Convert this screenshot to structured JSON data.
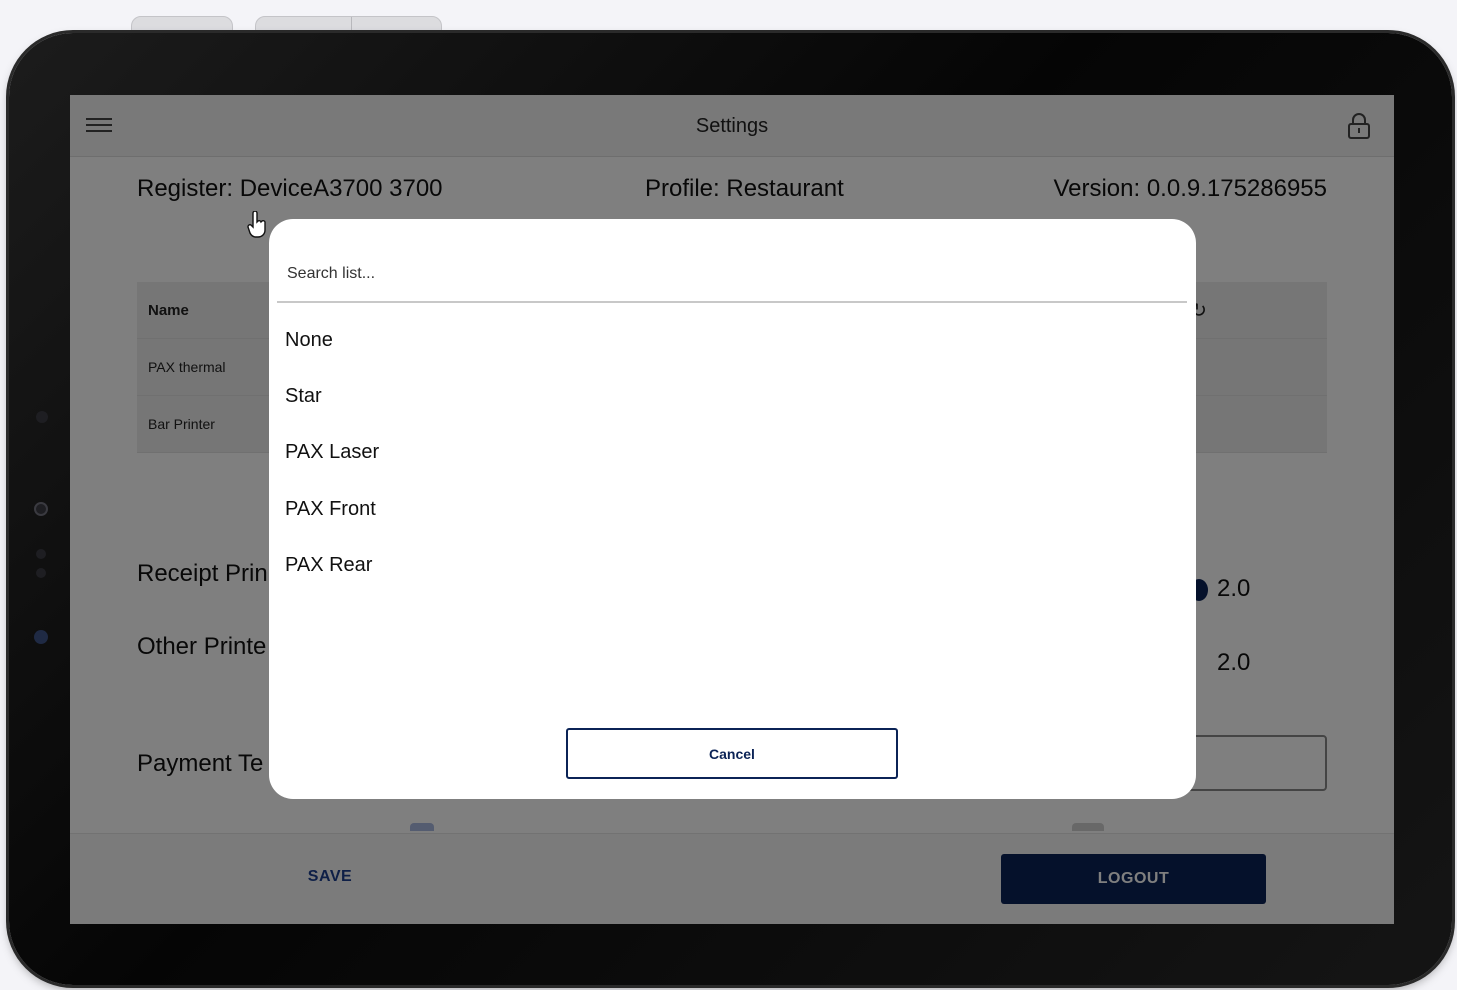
{
  "appbar": {
    "title": "Settings"
  },
  "info": {
    "register": "Register: DeviceA3700 3700",
    "profile": "Profile: Restaurant",
    "version": "Version: 0.0.9.175286955"
  },
  "printers": {
    "header": "Name",
    "rows": [
      "PAX thermal",
      "Bar Printer"
    ]
  },
  "settings": {
    "receipt_label": "Receipt Prin",
    "receipt_value": "2.0",
    "other_label": "Other Printe",
    "other_value": "2.0",
    "payment_label": "Payment Te"
  },
  "footer": {
    "save": "SAVE",
    "logout": "LOGOUT"
  },
  "dialog": {
    "search_placeholder": "Search list...",
    "options": [
      "None",
      "Star",
      "PAX Laser",
      "PAX Front",
      "PAX Rear"
    ],
    "cancel": "Cancel"
  },
  "colors": {
    "brand": "#0b2356",
    "accent_text": "#1c3f8f",
    "scrim": "rgba(0,0,0,0.5)"
  }
}
